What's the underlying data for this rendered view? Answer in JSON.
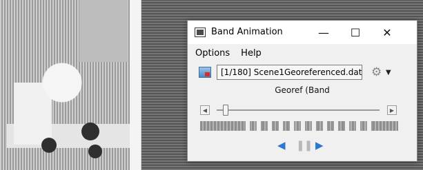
{
  "window": {
    "title": "Band Animation",
    "controls": {
      "minimize": "—",
      "maximize": "☐",
      "close": "✕"
    }
  },
  "menu": {
    "items": [
      "Options",
      "Help"
    ]
  },
  "file": {
    "label": "[1/180] Scene1Georeferenced.dat",
    "icon": "raster-file-icon"
  },
  "band_label": "Georef (Band",
  "slider": {
    "position_fraction": 0.04,
    "current_frame": 1,
    "total_frames": 180
  },
  "colors": {
    "accent": "#2a78d1",
    "window_bg": "#f0f0f0",
    "titlebar_bg": "#ffffff"
  },
  "icons": {
    "settings": "gear-icon",
    "dropdown": "chevron-down-icon",
    "back": "play-backward-icon",
    "pause": "pause-icon",
    "forward": "play-forward-icon"
  }
}
